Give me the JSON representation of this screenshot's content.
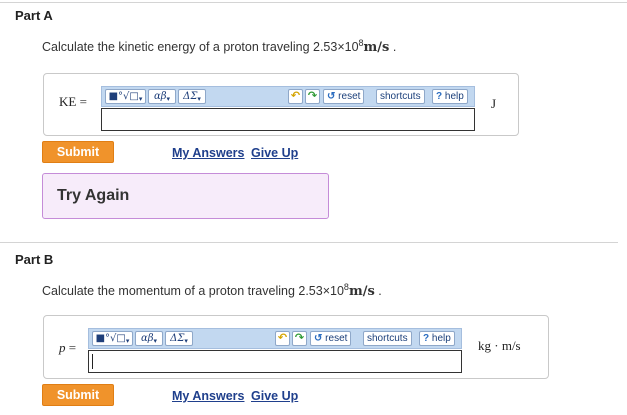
{
  "partA": {
    "title": "Part A",
    "question": {
      "prefix": "Calculate the kinetic energy of a proton traveling 2.53×10",
      "exponent": "8",
      "unit": "m/s",
      "suffix": " ."
    },
    "variable": "KE",
    "equals": "=",
    "unit": "J",
    "input_value": "",
    "submit_label": "Submit",
    "my_answers_label": "My Answers",
    "give_up_label": "Give Up",
    "feedback": "Try Again"
  },
  "partB": {
    "title": "Part B",
    "question": {
      "prefix": "Calculate the momentum of a proton traveling 2.53×10",
      "exponent": "8",
      "unit": "m/s",
      "suffix": " ."
    },
    "variable": "p",
    "equals": "=",
    "unit": "kg · m/s",
    "input_value": "",
    "submit_label": "Submit",
    "my_answers_label": "My Answers",
    "give_up_label": "Give Up"
  },
  "toolbar": {
    "templates": "■°√□",
    "greek": "αβ",
    "symbols": "ΔΣ",
    "caret": "▾",
    "undo": "↶",
    "redo": "↷",
    "reset_icon": "↺",
    "reset_label": "reset",
    "shortcuts_label": "shortcuts",
    "help_icon": "?",
    "help_label": "help"
  },
  "colors": {
    "submit_orange": "#f0932b",
    "toolbar_blue": "#c2d8f0",
    "link_blue": "#1f3f8c",
    "feedback_bg": "#f7ecfa",
    "feedback_border": "#c58cd8"
  }
}
